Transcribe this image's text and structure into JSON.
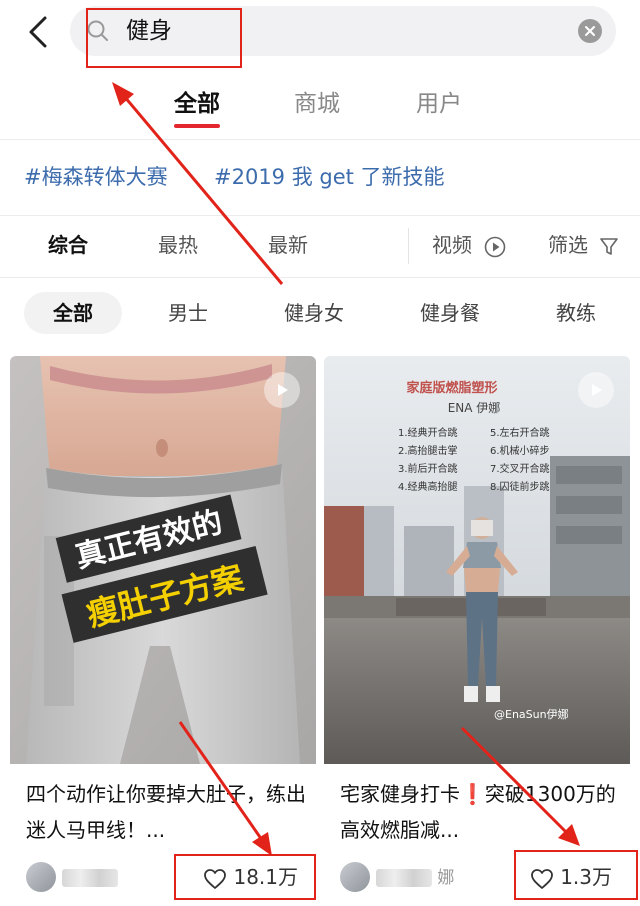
{
  "search": {
    "query": "健身"
  },
  "primary_tabs": [
    {
      "label": "全部",
      "active": true
    },
    {
      "label": "商城",
      "active": false
    },
    {
      "label": "用户",
      "active": false
    }
  ],
  "hashtags": [
    "#梅森转体大赛",
    "#2019 我 get 了新技能"
  ],
  "sort_options": [
    {
      "label": "综合",
      "active": true
    },
    {
      "label": "最热",
      "active": false
    },
    {
      "label": "最新",
      "active": false
    }
  ],
  "filters": {
    "video_label": "视频",
    "video_icon": "play-circle-icon",
    "filter_label": "筛选",
    "filter_icon": "funnel-icon"
  },
  "categories": [
    {
      "label": "全部",
      "active": true
    },
    {
      "label": "男士",
      "active": false
    },
    {
      "label": "健身女",
      "active": false
    },
    {
      "label": "健身餐",
      "active": false
    },
    {
      "label": "教练",
      "active": false
    }
  ],
  "cards": [
    {
      "overlay_line1": "真正有效的",
      "overlay_line2": "瘦肚子方案",
      "title": "四个动作让你要掉大肚子，练出迷人马甲线！...",
      "likes": "18.1万",
      "is_video": true
    },
    {
      "overlay_heading": "家庭版燃脂塑形",
      "overlay_brand": "ENA 伊娜",
      "overlay_list_left": [
        "1.经典开合跳",
        "2.高抬腿击掌",
        "3.前后开合跳",
        "4.经典高抬腿"
      ],
      "overlay_list_right": [
        "5.左右开合跳",
        "6.机械小碎步",
        "7.交叉开合跳",
        "8.囚徒前步跳"
      ],
      "overlay_watermark": "@EnaSun伊娜",
      "title_part1": "宅家健身打卡",
      "title_mark": "❗",
      "title_part2": "突破1300万的高效燃脂减...",
      "author_suffix": "娜",
      "likes": "1.3万",
      "is_video": true
    }
  ],
  "colors": {
    "accent_red": "#e3262f",
    "hashtag_blue": "#3d6cad",
    "annotation_red": "#e2231a"
  }
}
